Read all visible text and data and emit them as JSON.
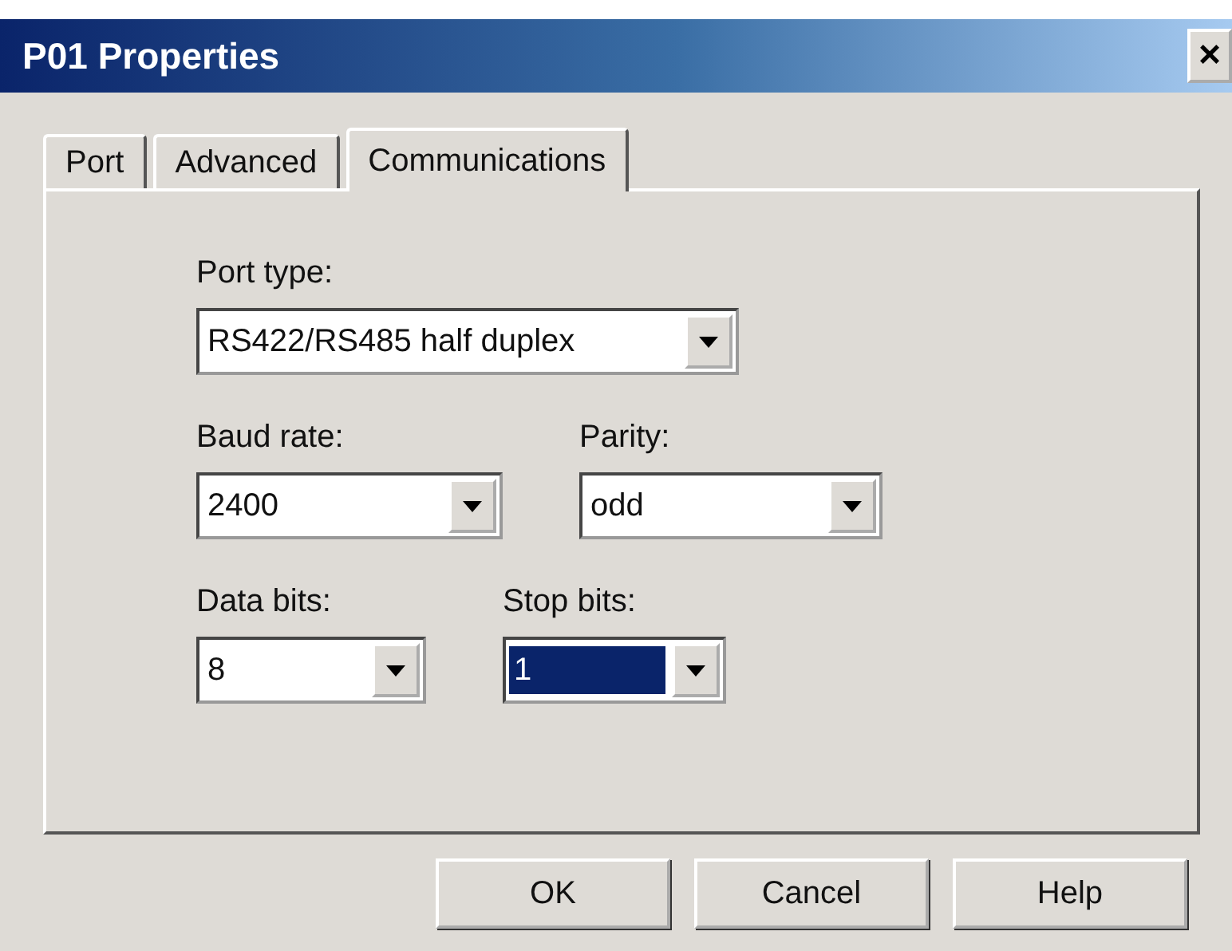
{
  "window": {
    "title": "P01 Properties",
    "close": "×"
  },
  "tabs": [
    {
      "label": "Port",
      "selected": false
    },
    {
      "label": "Advanced",
      "selected": false
    },
    {
      "label": "Communications",
      "selected": true
    }
  ],
  "rows": [
    [
      {
        "label": "Port type:",
        "value": "RS422/RS485 half duplex",
        "focused": false
      }
    ],
    [
      {
        "label": "Baud rate:",
        "value": "2400",
        "focused": false
      },
      {
        "label": "Parity:",
        "value": "odd",
        "focused": false
      }
    ],
    [
      {
        "label": "Data bits:",
        "value": "8",
        "focused": false
      },
      {
        "label": "Stop bits:",
        "value": "1",
        "focused": true
      }
    ]
  ],
  "buttons": [
    "OK",
    "Cancel",
    "Help"
  ]
}
